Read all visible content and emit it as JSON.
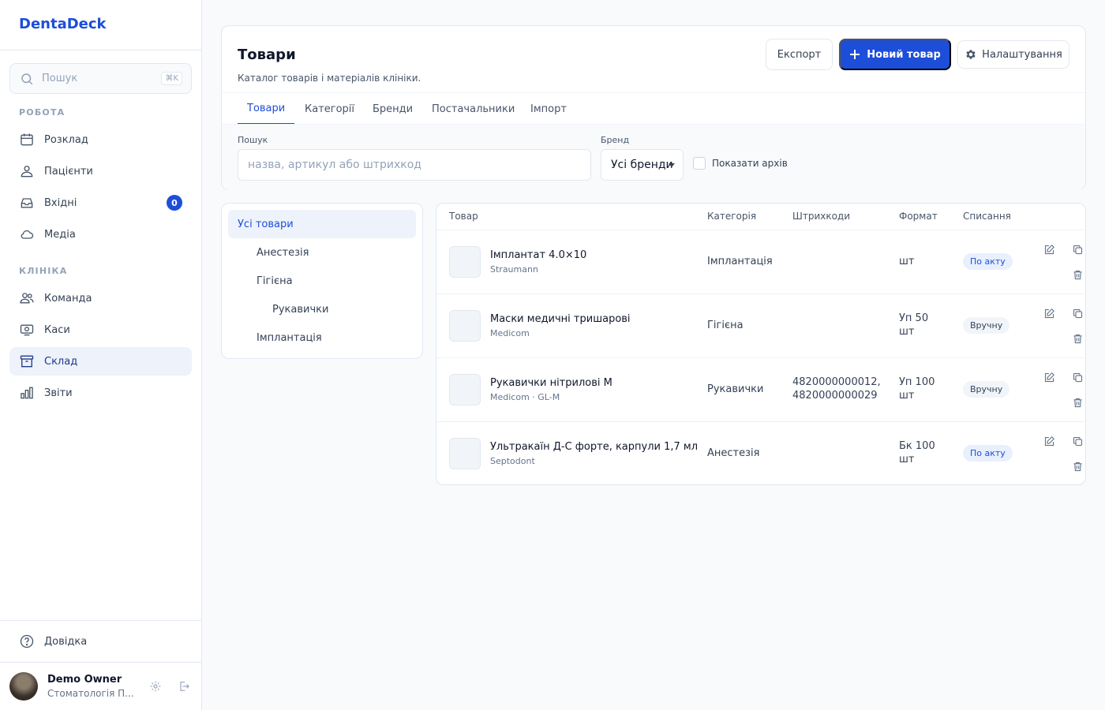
{
  "app": {
    "brand": "DentaDeck"
  },
  "sidebar": {
    "search_placeholder": "Пошук",
    "search_shortcut": "⌘K",
    "section_work": "РОБОТА",
    "section_clinic": "КЛІНІКА",
    "items": [
      {
        "label": "Розклад"
      },
      {
        "label": "Пацієнти"
      },
      {
        "label": "Вхідні",
        "badge": "0"
      },
      {
        "label": "Медіа"
      },
      {
        "label": "Команда"
      },
      {
        "label": "Каси"
      },
      {
        "label": "Склад"
      },
      {
        "label": "Звіти"
      }
    ],
    "help": "Довідка",
    "user": {
      "name": "Demo Owner",
      "org": "Стоматологія П..."
    }
  },
  "header": {
    "title": "Товари",
    "subtitle": "Каталог товарів і матеріалів клініки.",
    "export_label": "Експорт",
    "new_label": "Новий товар",
    "settings_label": "Налаштування"
  },
  "tabs": [
    "Товари",
    "Категорії",
    "Бренди",
    "Постачальники",
    "Імпорт"
  ],
  "filters": {
    "search_label": "Пошук",
    "search_placeholder": "назва, артикул або штрихкод",
    "brand_label": "Бренд",
    "brand_value": "Усі бренди",
    "archive_label": "Показати архів"
  },
  "tree": [
    "Усі товари",
    "Анестезія",
    "Гігієна",
    "Рукавички",
    "Імплантація"
  ],
  "table": {
    "headers": [
      "Товар",
      "Категорія",
      "Штрихкоди",
      "Формат",
      "Списання"
    ],
    "rows": [
      {
        "name": "Імплантат 4.0×10",
        "brand": "Straumann",
        "category": "Імплантація",
        "barcodes": "",
        "format1": "шт",
        "format2": "",
        "writeoff": "По акту"
      },
      {
        "name": "Маски медичні тришарові",
        "brand": "Medicom",
        "category": "Гігієна",
        "barcodes": "",
        "format1": "Уп 50",
        "format2": "шт",
        "writeoff": "Вручну"
      },
      {
        "name": "Рукавички нітрилові M",
        "brand": "Medicom · GL-M",
        "category": "Рукавички",
        "barcodes": "4820000000012,",
        "barcodes2": "4820000000029",
        "format1": "Уп 100",
        "format2": "шт",
        "writeoff": "Вручну"
      },
      {
        "name": "Ультракаїн Д-С форте, карпули 1,7 мл",
        "brand": "Septodont",
        "category": "Анестезія",
        "barcodes": "",
        "format1": "Бк 100",
        "format2": "шт",
        "writeoff": "По акту"
      }
    ]
  }
}
